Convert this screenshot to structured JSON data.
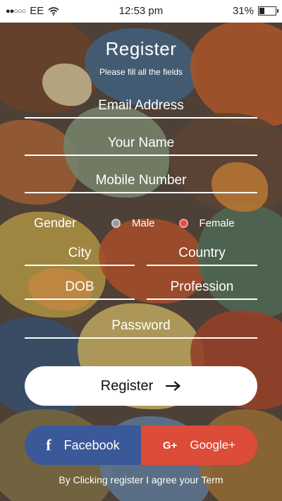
{
  "status": {
    "carrier": "EE",
    "time": "12:53 pm",
    "battery": "31%",
    "battery_level": 0.31
  },
  "header": {
    "title": "Register",
    "subtitle": "Please fill all the fields"
  },
  "form": {
    "email_placeholder": "Email Address",
    "name_placeholder": "Your Name",
    "mobile_placeholder": "Mobile Number",
    "gender_label": "Gender",
    "gender_options": [
      "Male",
      "Female"
    ],
    "gender_selected": "Female",
    "city_placeholder": "City",
    "country_placeholder": "Country",
    "dob_placeholder": "DOB",
    "profession_placeholder": "Profession",
    "password_placeholder": "Password"
  },
  "actions": {
    "register_label": "Register",
    "facebook_label": "Facebook",
    "google_label": "Google+",
    "terms_text": "By Clicking register I agree your Term"
  },
  "colors": {
    "facebook": "#3b5998",
    "google": "#dd4b39",
    "selected_radio": "#e84a4a"
  }
}
